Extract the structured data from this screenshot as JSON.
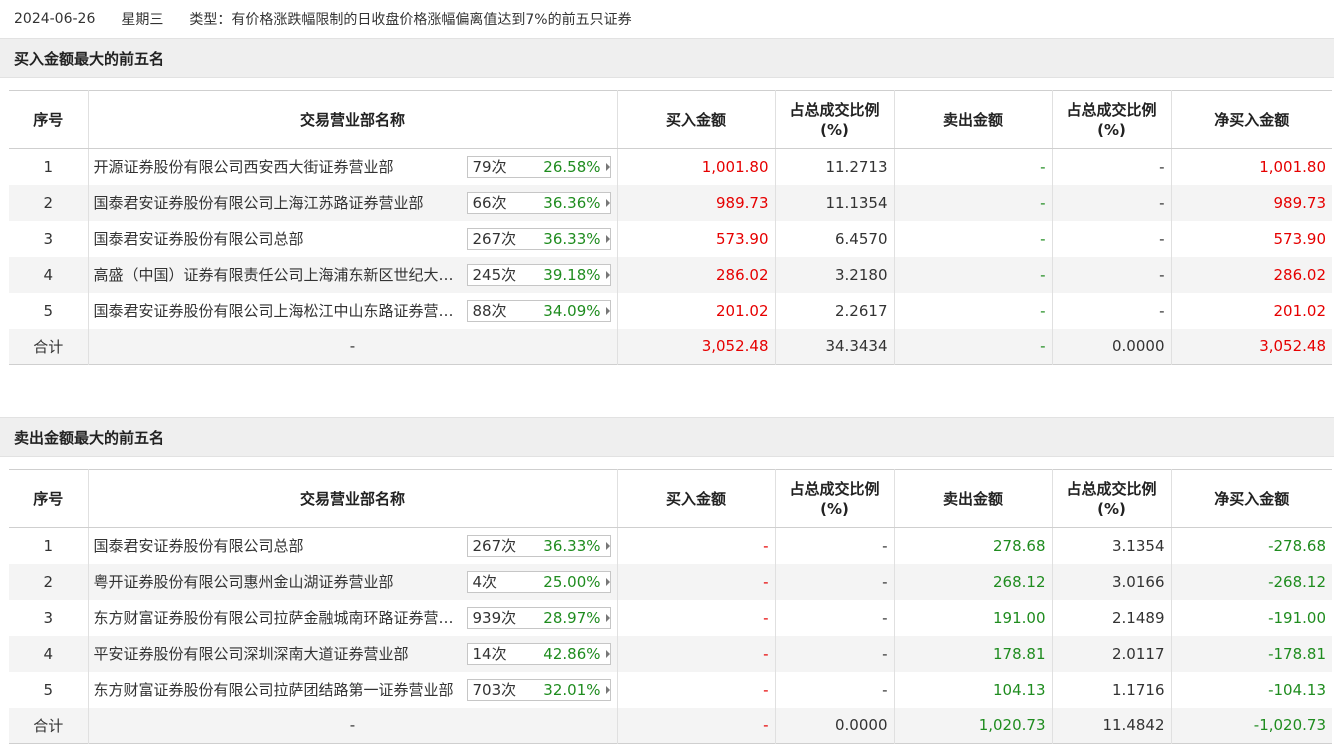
{
  "header": {
    "date": "2024-06-26",
    "weekday": "星期三",
    "type_label": "类型：有价格涨跌幅限制的日收盘价格涨幅偏离值达到7%的前五只证券"
  },
  "columns": [
    "序号",
    "交易营业部名称",
    "买入金额",
    "占总成交比例\n(%)",
    "卖出金额",
    "占总成交比例\n(%)",
    "净买入金额"
  ],
  "buy_section": {
    "title": "买入金额最大的前五名",
    "rows": [
      {
        "no": "1",
        "name": "开源证券股份有限公司西安西大街证券营业部",
        "count": "79次",
        "pct": "26.58%",
        "buy": "1,001.80",
        "buy_ratio": "11.2713",
        "sell": "-",
        "sell_ratio": "-",
        "net": "1,001.80"
      },
      {
        "no": "2",
        "name": "国泰君安证券股份有限公司上海江苏路证券营业部",
        "count": "66次",
        "pct": "36.36%",
        "buy": "989.73",
        "buy_ratio": "11.1354",
        "sell": "-",
        "sell_ratio": "-",
        "net": "989.73"
      },
      {
        "no": "3",
        "name": "国泰君安证券股份有限公司总部",
        "count": "267次",
        "pct": "36.33%",
        "buy": "573.90",
        "buy_ratio": "6.4570",
        "sell": "-",
        "sell_ratio": "-",
        "net": "573.90"
      },
      {
        "no": "4",
        "name": "高盛（中国）证券有限责任公司上海浦东新区世纪大道证券营业部",
        "count": "245次",
        "pct": "39.18%",
        "buy": "286.02",
        "buy_ratio": "3.2180",
        "sell": "-",
        "sell_ratio": "-",
        "net": "286.02"
      },
      {
        "no": "5",
        "name": "国泰君安证券股份有限公司上海松江中山东路证券营业部",
        "count": "88次",
        "pct": "34.09%",
        "buy": "201.02",
        "buy_ratio": "2.2617",
        "sell": "-",
        "sell_ratio": "-",
        "net": "201.02"
      }
    ],
    "total": {
      "label": "合计",
      "name": "-",
      "buy": "3,052.48",
      "buy_ratio": "34.3434",
      "sell": "-",
      "sell_ratio": "0.0000",
      "net": "3,052.48"
    }
  },
  "sell_section": {
    "title": "卖出金额最大的前五名",
    "rows": [
      {
        "no": "1",
        "name": "国泰君安证券股份有限公司总部",
        "count": "267次",
        "pct": "36.33%",
        "buy": "-",
        "buy_ratio": "-",
        "sell": "278.68",
        "sell_ratio": "3.1354",
        "net": "-278.68"
      },
      {
        "no": "2",
        "name": "粤开证券股份有限公司惠州金山湖证券营业部",
        "count": "4次",
        "pct": "25.00%",
        "buy": "-",
        "buy_ratio": "-",
        "sell": "268.12",
        "sell_ratio": "3.0166",
        "net": "-268.12"
      },
      {
        "no": "3",
        "name": "东方财富证券股份有限公司拉萨金融城南环路证券营业部",
        "count": "939次",
        "pct": "28.97%",
        "buy": "-",
        "buy_ratio": "-",
        "sell": "191.00",
        "sell_ratio": "2.1489",
        "net": "-191.00"
      },
      {
        "no": "4",
        "name": "平安证券股份有限公司深圳深南大道证券营业部",
        "count": "14次",
        "pct": "42.86%",
        "buy": "-",
        "buy_ratio": "-",
        "sell": "178.81",
        "sell_ratio": "2.0117",
        "net": "-178.81"
      },
      {
        "no": "5",
        "name": "东方财富证券股份有限公司拉萨团结路第一证券营业部",
        "count": "703次",
        "pct": "32.01%",
        "buy": "-",
        "buy_ratio": "-",
        "sell": "104.13",
        "sell_ratio": "1.1716",
        "net": "-104.13"
      }
    ],
    "total": {
      "label": "合计",
      "name": "-",
      "buy": "-",
      "buy_ratio": "0.0000",
      "sell": "1,020.73",
      "sell_ratio": "11.4842",
      "net": "-1,020.73"
    }
  },
  "colors": {
    "positive": "#e60000",
    "negative": "#1f8c1f",
    "section_bg": "#efefef",
    "alt_row": "#f4f4f4"
  }
}
